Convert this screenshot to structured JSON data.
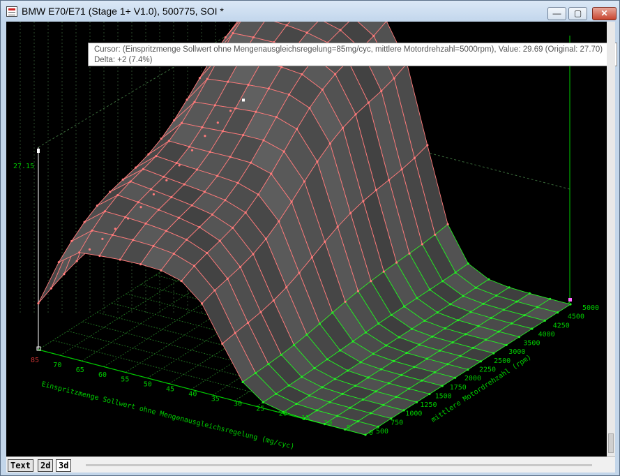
{
  "window": {
    "title": "BMW E70/E71 (Stage 1+ V1.0), 500775, SOI *",
    "minimize": "—",
    "maximize": "▢",
    "close": "✕"
  },
  "tooltip": {
    "line1": "Cursor: (Einspritzmenge Sollwert ohne Mengenausgleichsregelung=85mg/cyc, mittlere Motordrehzahl=5000rpm), Value: 29.69 (Original: 27.70)",
    "line2": "Delta: +2 (7.4%)"
  },
  "chart_data": {
    "type": "surface",
    "z_marker_label": "27.15",
    "x_axis": {
      "label": "Einspritzmenge Sollwert ohne Mengenausgleichsregelung (mg/cyc)",
      "ticks": [
        "85",
        "70",
        "65",
        "60",
        "55",
        "50",
        "45",
        "40",
        "35",
        "30",
        "25",
        "20",
        "15",
        "10",
        "5",
        "0"
      ]
    },
    "y_axis": {
      "label": "mittlere Motordrehzahl (rpm)",
      "ticks": [
        "500",
        "750",
        "1000",
        "1250",
        "1500",
        "1750",
        "2000",
        "2250",
        "2500",
        "3000",
        "3500",
        "4000",
        "4250",
        "4500",
        "5000"
      ]
    },
    "colors": {
      "modified_grid": "#ff7a7a",
      "original_grid": "#22ee22",
      "surface": "#4a4a4a",
      "axis": "#00cc00"
    },
    "grid": true
  },
  "tabs": [
    {
      "label": "Text"
    },
    {
      "label": "2d"
    },
    {
      "label": "3d"
    }
  ]
}
